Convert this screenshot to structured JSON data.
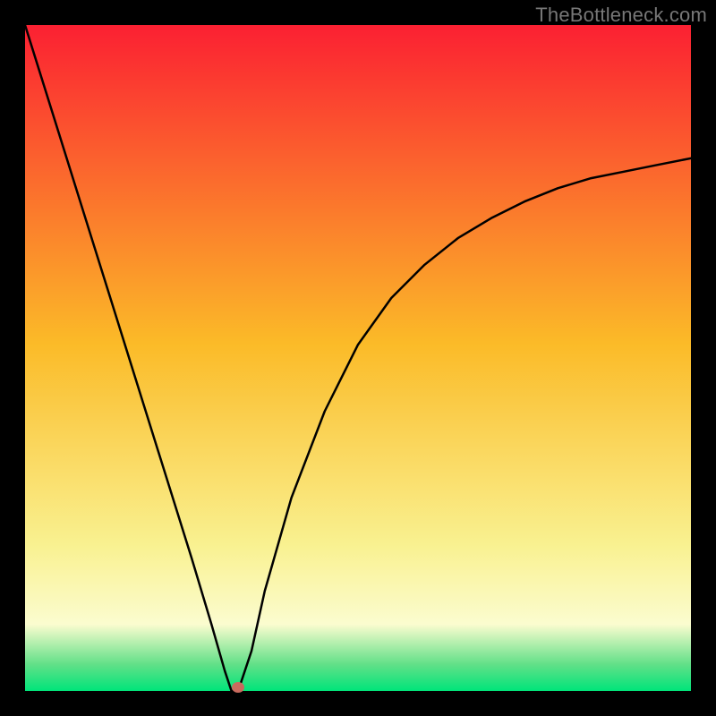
{
  "watermark": "TheBottleneck.com",
  "chart_data": {
    "type": "line",
    "title": "",
    "xlabel": "",
    "ylabel": "",
    "xlim": [
      0,
      100
    ],
    "ylim": [
      0,
      100
    ],
    "grid": false,
    "background_gradient": {
      "top": "#fb2032",
      "mid_warm": "#fbbb28",
      "mid_yellow": "#f9f190",
      "low_yellow": "#fbfccf",
      "low_green": "#62e088",
      "bottom": "#00e47a"
    },
    "series": [
      {
        "name": "bottleneck-curve",
        "x": [
          0,
          5,
          10,
          15,
          20,
          25,
          28,
          30,
          31,
          32,
          34,
          36,
          40,
          45,
          50,
          55,
          60,
          65,
          70,
          75,
          80,
          85,
          90,
          95,
          100
        ],
        "values": [
          100,
          84,
          68,
          52,
          36,
          20,
          10,
          3,
          0,
          0,
          6,
          15,
          29,
          42,
          52,
          59,
          64,
          68,
          71,
          73.5,
          75.5,
          77,
          78,
          79,
          80
        ]
      }
    ],
    "marker": {
      "name": "optimal-point",
      "x": 32,
      "y": 0.5,
      "color": "#c96a5e"
    }
  }
}
